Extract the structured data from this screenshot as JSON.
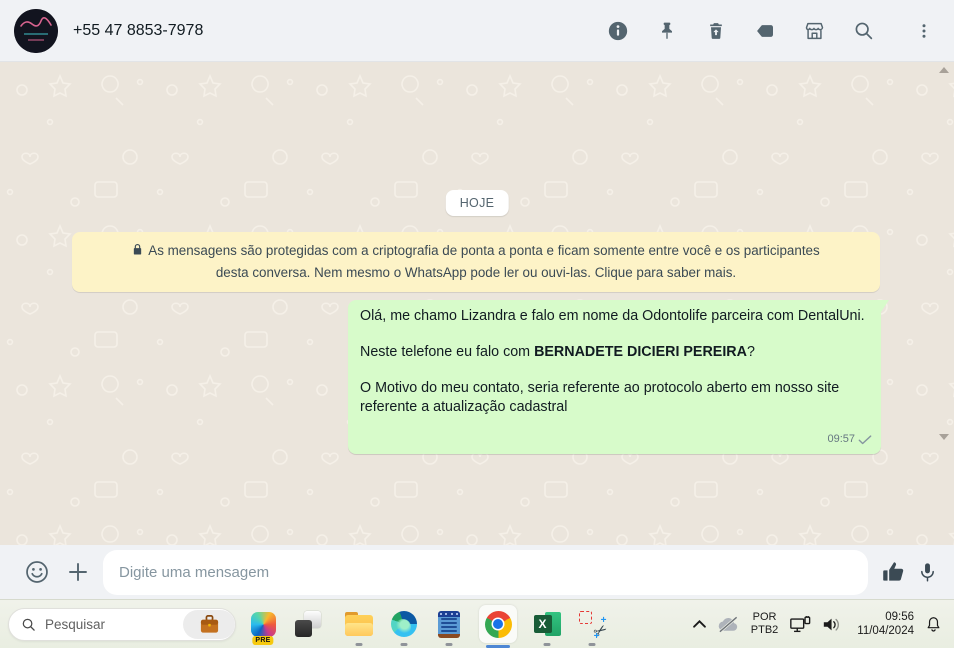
{
  "chat_header": {
    "title": "+55 47 8853-7978",
    "action_icons": [
      "info",
      "pin",
      "delete",
      "label",
      "storefront",
      "search",
      "menu"
    ]
  },
  "chat": {
    "date_divider": "HOJE",
    "encryption_notice": {
      "text": "As mensagens são protegidas com a criptografia de ponta a ponta e ficam somente entre você e os participantes desta conversa. Nem mesmo o WhatsApp pode ler ou ouvi-las.",
      "link": "Clique para saber mais."
    },
    "message": {
      "direction": "outgoing",
      "p1": "Olá, me chamo Lizandra e falo em nome da Odontolife parceira com DentalUni.",
      "p2_prefix": "Neste telefone eu falo com ",
      "p2_bold": "BERNADETE DICIERI PEREIRA",
      "p2_suffix": "?",
      "p3": "O Motivo do meu contato, seria referente ao protocolo aberto em nosso site referente a atualização cadastral",
      "time": "09:57",
      "status": "sent"
    }
  },
  "composer": {
    "placeholder": "Digite uma mensagem"
  },
  "taskbar": {
    "search_placeholder": "Pesquisar",
    "copilot_badge": "PRE",
    "tray": {
      "language_line1": "POR",
      "language_line2": "PTB2",
      "time": "09:56",
      "date": "11/04/2024"
    }
  },
  "colors": {
    "header_bg": "#f0f2f5",
    "chat_bg": "#ebe5dc",
    "outgoing_bubble": "#d7fbca",
    "notice_bg": "#fdf3c7",
    "icon_color": "#54656f",
    "taskbar_bg": "#edf0e7",
    "chrome_active_underline": "#4e87d4"
  }
}
